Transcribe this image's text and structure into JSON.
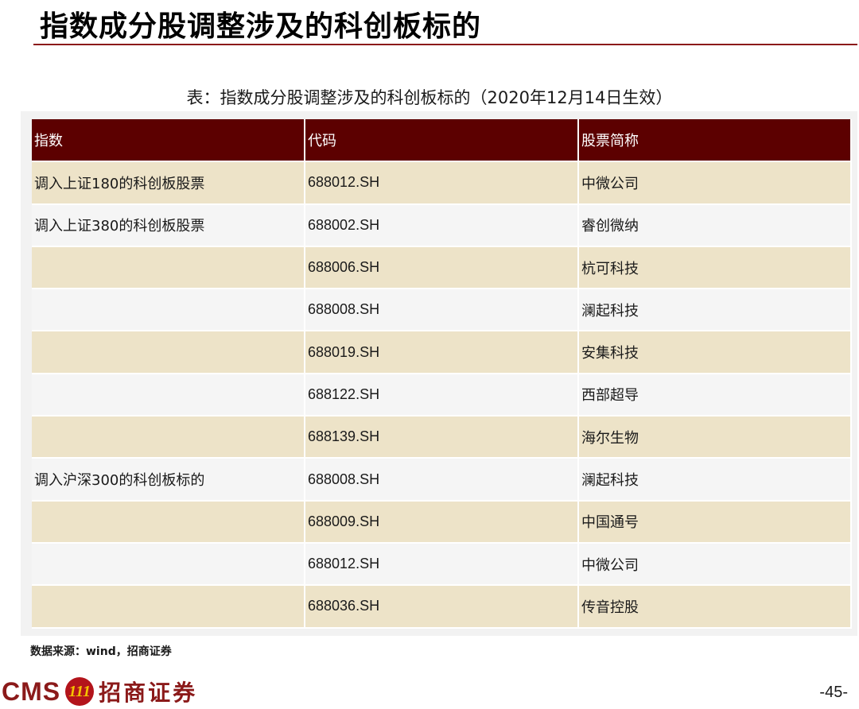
{
  "title": "指数成分股调整涉及的科创板标的",
  "caption": "表：指数成分股调整涉及的科创板标的（2020年12月14日生效）",
  "table": {
    "headers": [
      "指数",
      "代码",
      "股票简称"
    ],
    "rows": [
      {
        "index": "调入上证180的科创板股票",
        "code": "688012.SH",
        "name": "中微公司"
      },
      {
        "index": "调入上证380的科创板股票",
        "code": "688002.SH",
        "name": "睿创微纳"
      },
      {
        "index": "",
        "code": "688006.SH",
        "name": "杭可科技"
      },
      {
        "index": "",
        "code": "688008.SH",
        "name": "澜起科技"
      },
      {
        "index": "",
        "code": "688019.SH",
        "name": "安集科技"
      },
      {
        "index": "",
        "code": "688122.SH",
        "name": "西部超导"
      },
      {
        "index": "",
        "code": "688139.SH",
        "name": "海尔生物"
      },
      {
        "index": "调入沪深300的科创板标的",
        "code": "688008.SH",
        "name": "澜起科技"
      },
      {
        "index": "",
        "code": "688009.SH",
        "name": "中国通号"
      },
      {
        "index": "",
        "code": "688012.SH",
        "name": "中微公司"
      },
      {
        "index": "",
        "code": "688036.SH",
        "name": "传音控股"
      }
    ]
  },
  "source": "数据来源：wind，招商证券",
  "footer": {
    "logo_text": "CMS",
    "logo_emblem": "111",
    "logo_cn": "招商证券",
    "page_number": "-45-"
  },
  "colors": {
    "header_bg": "#5c0000",
    "odd_row_bg": "#ede3c8",
    "even_row_bg": "#f5f5f5",
    "brand": "#8b1a1a"
  }
}
